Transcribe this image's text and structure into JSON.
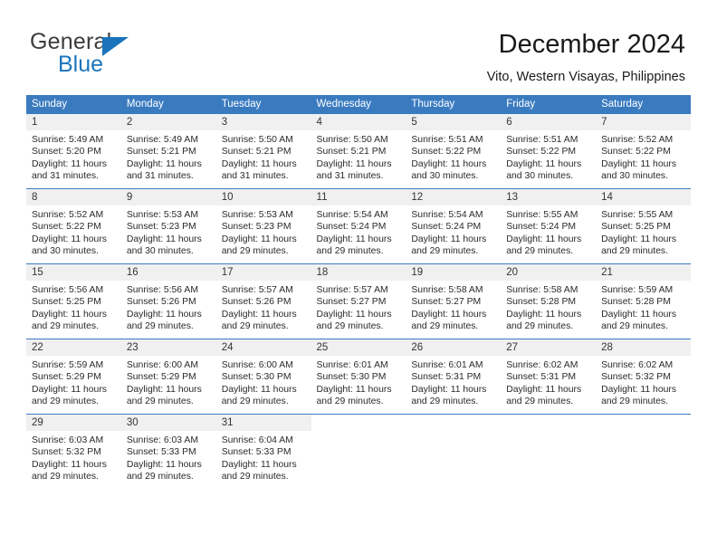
{
  "logo": {
    "word1": "General",
    "word2": "Blue",
    "triangle_color": "#1b74bb",
    "word1_color": "#3c3c3b",
    "word2_color": "#1b74bb"
  },
  "header": {
    "title": "December 2024",
    "subtitle": "Vito, Western Visayas, Philippines"
  },
  "theme": {
    "header_blue": "#3a7bc0",
    "daynum_gray": "#f0f0f0",
    "text": "#2a2a2a"
  },
  "calendar": {
    "weekday_headers": [
      "Sunday",
      "Monday",
      "Tuesday",
      "Wednesday",
      "Thursday",
      "Friday",
      "Saturday"
    ],
    "weeks": [
      [
        {
          "day": "1",
          "sunrise": "Sunrise: 5:49 AM",
          "sunset": "Sunset: 5:20 PM",
          "daylight1": "Daylight: 11 hours",
          "daylight2": "and 31 minutes."
        },
        {
          "day": "2",
          "sunrise": "Sunrise: 5:49 AM",
          "sunset": "Sunset: 5:21 PM",
          "daylight1": "Daylight: 11 hours",
          "daylight2": "and 31 minutes."
        },
        {
          "day": "3",
          "sunrise": "Sunrise: 5:50 AM",
          "sunset": "Sunset: 5:21 PM",
          "daylight1": "Daylight: 11 hours",
          "daylight2": "and 31 minutes."
        },
        {
          "day": "4",
          "sunrise": "Sunrise: 5:50 AM",
          "sunset": "Sunset: 5:21 PM",
          "daylight1": "Daylight: 11 hours",
          "daylight2": "and 31 minutes."
        },
        {
          "day": "5",
          "sunrise": "Sunrise: 5:51 AM",
          "sunset": "Sunset: 5:22 PM",
          "daylight1": "Daylight: 11 hours",
          "daylight2": "and 30 minutes."
        },
        {
          "day": "6",
          "sunrise": "Sunrise: 5:51 AM",
          "sunset": "Sunset: 5:22 PM",
          "daylight1": "Daylight: 11 hours",
          "daylight2": "and 30 minutes."
        },
        {
          "day": "7",
          "sunrise": "Sunrise: 5:52 AM",
          "sunset": "Sunset: 5:22 PM",
          "daylight1": "Daylight: 11 hours",
          "daylight2": "and 30 minutes."
        }
      ],
      [
        {
          "day": "8",
          "sunrise": "Sunrise: 5:52 AM",
          "sunset": "Sunset: 5:22 PM",
          "daylight1": "Daylight: 11 hours",
          "daylight2": "and 30 minutes."
        },
        {
          "day": "9",
          "sunrise": "Sunrise: 5:53 AM",
          "sunset": "Sunset: 5:23 PM",
          "daylight1": "Daylight: 11 hours",
          "daylight2": "and 30 minutes."
        },
        {
          "day": "10",
          "sunrise": "Sunrise: 5:53 AM",
          "sunset": "Sunset: 5:23 PM",
          "daylight1": "Daylight: 11 hours",
          "daylight2": "and 29 minutes."
        },
        {
          "day": "11",
          "sunrise": "Sunrise: 5:54 AM",
          "sunset": "Sunset: 5:24 PM",
          "daylight1": "Daylight: 11 hours",
          "daylight2": "and 29 minutes."
        },
        {
          "day": "12",
          "sunrise": "Sunrise: 5:54 AM",
          "sunset": "Sunset: 5:24 PM",
          "daylight1": "Daylight: 11 hours",
          "daylight2": "and 29 minutes."
        },
        {
          "day": "13",
          "sunrise": "Sunrise: 5:55 AM",
          "sunset": "Sunset: 5:24 PM",
          "daylight1": "Daylight: 11 hours",
          "daylight2": "and 29 minutes."
        },
        {
          "day": "14",
          "sunrise": "Sunrise: 5:55 AM",
          "sunset": "Sunset: 5:25 PM",
          "daylight1": "Daylight: 11 hours",
          "daylight2": "and 29 minutes."
        }
      ],
      [
        {
          "day": "15",
          "sunrise": "Sunrise: 5:56 AM",
          "sunset": "Sunset: 5:25 PM",
          "daylight1": "Daylight: 11 hours",
          "daylight2": "and 29 minutes."
        },
        {
          "day": "16",
          "sunrise": "Sunrise: 5:56 AM",
          "sunset": "Sunset: 5:26 PM",
          "daylight1": "Daylight: 11 hours",
          "daylight2": "and 29 minutes."
        },
        {
          "day": "17",
          "sunrise": "Sunrise: 5:57 AM",
          "sunset": "Sunset: 5:26 PM",
          "daylight1": "Daylight: 11 hours",
          "daylight2": "and 29 minutes."
        },
        {
          "day": "18",
          "sunrise": "Sunrise: 5:57 AM",
          "sunset": "Sunset: 5:27 PM",
          "daylight1": "Daylight: 11 hours",
          "daylight2": "and 29 minutes."
        },
        {
          "day": "19",
          "sunrise": "Sunrise: 5:58 AM",
          "sunset": "Sunset: 5:27 PM",
          "daylight1": "Daylight: 11 hours",
          "daylight2": "and 29 minutes."
        },
        {
          "day": "20",
          "sunrise": "Sunrise: 5:58 AM",
          "sunset": "Sunset: 5:28 PM",
          "daylight1": "Daylight: 11 hours",
          "daylight2": "and 29 minutes."
        },
        {
          "day": "21",
          "sunrise": "Sunrise: 5:59 AM",
          "sunset": "Sunset: 5:28 PM",
          "daylight1": "Daylight: 11 hours",
          "daylight2": "and 29 minutes."
        }
      ],
      [
        {
          "day": "22",
          "sunrise": "Sunrise: 5:59 AM",
          "sunset": "Sunset: 5:29 PM",
          "daylight1": "Daylight: 11 hours",
          "daylight2": "and 29 minutes."
        },
        {
          "day": "23",
          "sunrise": "Sunrise: 6:00 AM",
          "sunset": "Sunset: 5:29 PM",
          "daylight1": "Daylight: 11 hours",
          "daylight2": "and 29 minutes."
        },
        {
          "day": "24",
          "sunrise": "Sunrise: 6:00 AM",
          "sunset": "Sunset: 5:30 PM",
          "daylight1": "Daylight: 11 hours",
          "daylight2": "and 29 minutes."
        },
        {
          "day": "25",
          "sunrise": "Sunrise: 6:01 AM",
          "sunset": "Sunset: 5:30 PM",
          "daylight1": "Daylight: 11 hours",
          "daylight2": "and 29 minutes."
        },
        {
          "day": "26",
          "sunrise": "Sunrise: 6:01 AM",
          "sunset": "Sunset: 5:31 PM",
          "daylight1": "Daylight: 11 hours",
          "daylight2": "and 29 minutes."
        },
        {
          "day": "27",
          "sunrise": "Sunrise: 6:02 AM",
          "sunset": "Sunset: 5:31 PM",
          "daylight1": "Daylight: 11 hours",
          "daylight2": "and 29 minutes."
        },
        {
          "day": "28",
          "sunrise": "Sunrise: 6:02 AM",
          "sunset": "Sunset: 5:32 PM",
          "daylight1": "Daylight: 11 hours",
          "daylight2": "and 29 minutes."
        }
      ],
      [
        {
          "day": "29",
          "sunrise": "Sunrise: 6:03 AM",
          "sunset": "Sunset: 5:32 PM",
          "daylight1": "Daylight: 11 hours",
          "daylight2": "and 29 minutes."
        },
        {
          "day": "30",
          "sunrise": "Sunrise: 6:03 AM",
          "sunset": "Sunset: 5:33 PM",
          "daylight1": "Daylight: 11 hours",
          "daylight2": "and 29 minutes."
        },
        {
          "day": "31",
          "sunrise": "Sunrise: 6:04 AM",
          "sunset": "Sunset: 5:33 PM",
          "daylight1": "Daylight: 11 hours",
          "daylight2": "and 29 minutes."
        },
        {
          "day": "",
          "sunrise": "",
          "sunset": "",
          "daylight1": "",
          "daylight2": ""
        },
        {
          "day": "",
          "sunrise": "",
          "sunset": "",
          "daylight1": "",
          "daylight2": ""
        },
        {
          "day": "",
          "sunrise": "",
          "sunset": "",
          "daylight1": "",
          "daylight2": ""
        },
        {
          "day": "",
          "sunrise": "",
          "sunset": "",
          "daylight1": "",
          "daylight2": ""
        }
      ]
    ]
  }
}
